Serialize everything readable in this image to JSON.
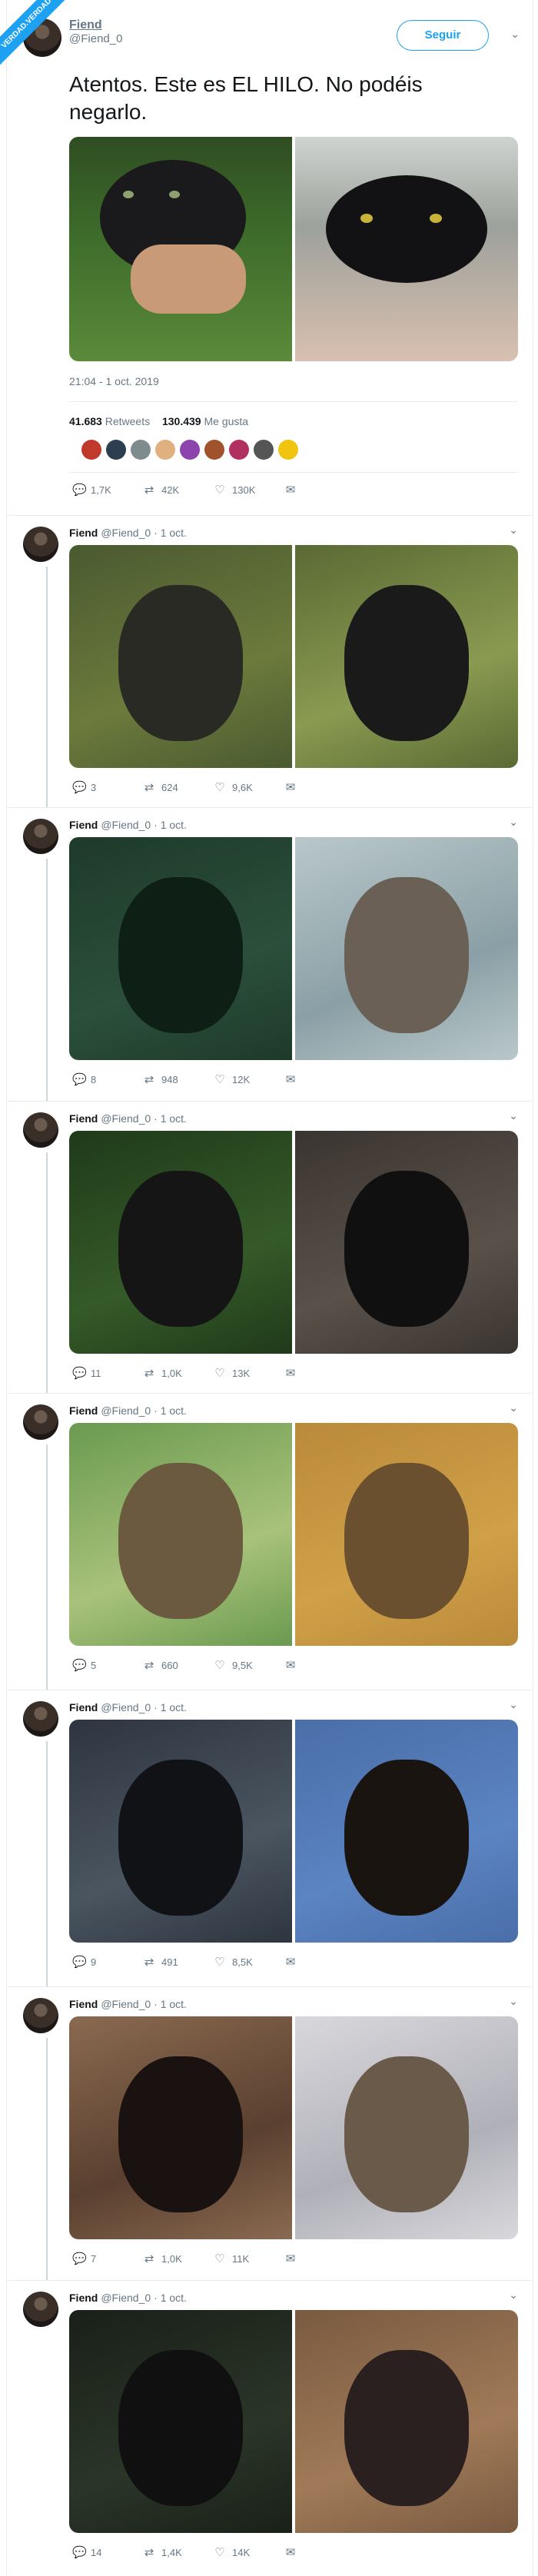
{
  "watermark": "VERDAD.VERDAD",
  "main_tweet": {
    "name": "Fiend",
    "handle": "@Fiend_0",
    "follow_label": "Seguir",
    "text": "Atentos. Este es EL HILO. No podéis negarlo.",
    "timestamp": "21:04 - 1 oct. 2019",
    "retweets": "41.683",
    "retweets_label": "Retweets",
    "likes": "130.439",
    "likes_label": "Me gusta",
    "reply_count": "1,7K",
    "retweet_count": "42K",
    "like_count": "130K"
  },
  "replies": [
    {
      "name": "Fiend",
      "handle": "@Fiend_0",
      "date": "· 1 oct.",
      "reply_count": "3",
      "retweet_count": "624",
      "like_count": "9,6K"
    },
    {
      "name": "Fiend",
      "handle": "@Fiend_0",
      "date": "· 1 oct.",
      "reply_count": "8",
      "retweet_count": "948",
      "like_count": "12K"
    },
    {
      "name": "Fiend",
      "handle": "@Fiend_0",
      "date": "· 1 oct.",
      "reply_count": "11",
      "retweet_count": "1,0K",
      "like_count": "13K"
    },
    {
      "name": "Fiend",
      "handle": "@Fiend_0",
      "date": "· 1 oct.",
      "reply_count": "5",
      "retweet_count": "660",
      "like_count": "9,5K"
    },
    {
      "name": "Fiend",
      "handle": "@Fiend_0",
      "date": "· 1 oct.",
      "reply_count": "9",
      "retweet_count": "491",
      "like_count": "8,5K"
    },
    {
      "name": "Fiend",
      "handle": "@Fiend_0",
      "date": "· 1 oct.",
      "reply_count": "7",
      "retweet_count": "1,0K",
      "like_count": "11K"
    },
    {
      "name": "Fiend",
      "handle": "@Fiend_0",
      "date": "· 1 oct.",
      "reply_count": "14",
      "retweet_count": "1,4K",
      "like_count": "14K"
    }
  ],
  "colors": {
    "accent": "#1da1f2",
    "muted": "#657786",
    "border": "#e6ecf0"
  },
  "icons": {
    "reply": "reply-icon",
    "retweet": "retweet-icon",
    "like": "heart-icon",
    "dm": "mail-icon",
    "more": "chevron-down-icon"
  }
}
